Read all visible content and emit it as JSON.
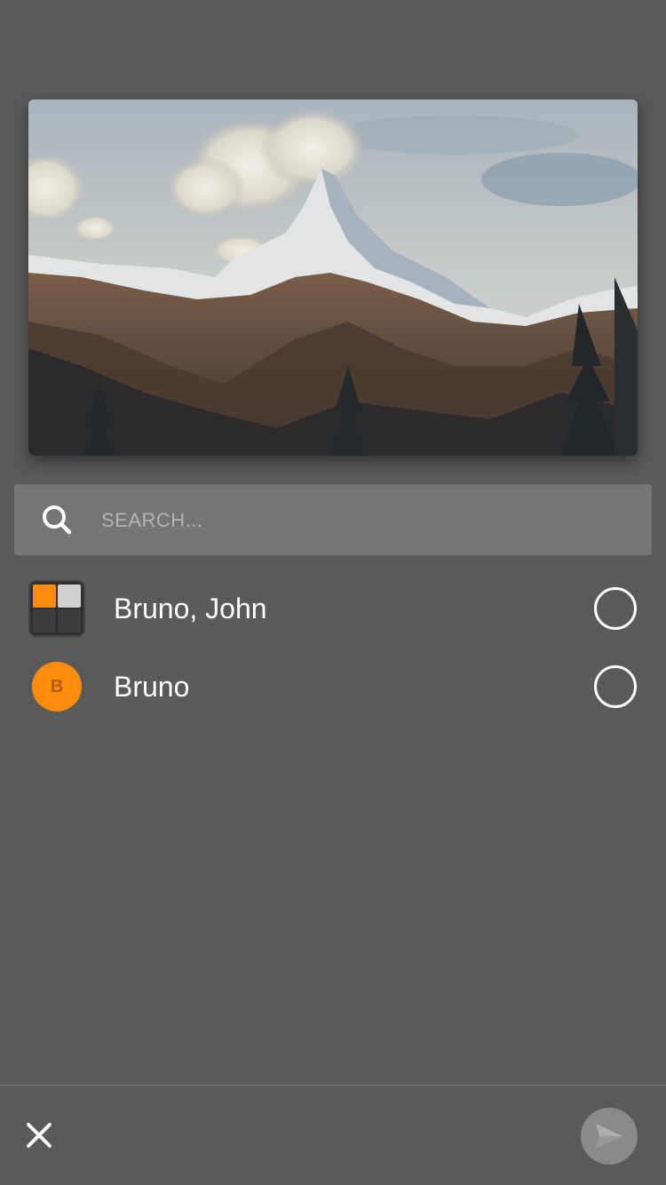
{
  "photo": {
    "icon": "mountain-photo"
  },
  "search": {
    "placeholder": "SEARCH...",
    "value": "",
    "icon": "search-icon"
  },
  "contacts": [
    {
      "name": "Bruno, John",
      "avatar_type": "group",
      "avatar_colors": [
        "#ff8c0a",
        "#cfcfcf",
        "#3c3c3c",
        "#3c3c3c"
      ],
      "selected": false
    },
    {
      "name": "Bruno",
      "avatar_type": "initial",
      "initial": "B",
      "avatar_color": "#ff8c0a",
      "selected": false
    }
  ],
  "bottom_bar": {
    "close_icon": "close-icon",
    "send_icon": "send-icon",
    "send_enabled": false
  },
  "colors": {
    "background": "#5a5a5a",
    "search_bar": "#757575",
    "accent": "#ff8c0a",
    "send_button": "#8a8a8a"
  }
}
